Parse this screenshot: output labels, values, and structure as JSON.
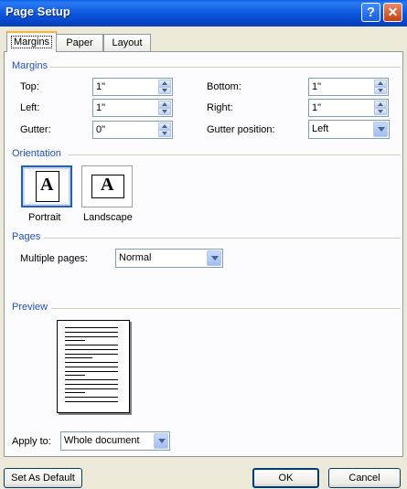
{
  "window": {
    "title": "Page Setup",
    "help_glyph": "?",
    "close_glyph": "✕"
  },
  "tabs": [
    {
      "label": "Margins",
      "active": true
    },
    {
      "label": "Paper",
      "active": false
    },
    {
      "label": "Layout",
      "active": false
    }
  ],
  "margins": {
    "section_label": "Margins",
    "top": {
      "label": "Top:",
      "value": "1\""
    },
    "bottom": {
      "label": "Bottom:",
      "value": "1\""
    },
    "left": {
      "label": "Left:",
      "value": "1\""
    },
    "right": {
      "label": "Right:",
      "value": "1\""
    },
    "gutter": {
      "label": "Gutter:",
      "value": "0\""
    },
    "gutter_position": {
      "label": "Gutter position:",
      "value": "Left"
    }
  },
  "orientation": {
    "section_label": "Orientation",
    "portrait": {
      "label": "Portrait",
      "glyph": "A",
      "selected": true
    },
    "landscape": {
      "label": "Landscape",
      "glyph": "A",
      "selected": false
    }
  },
  "pages": {
    "section_label": "Pages",
    "multiple_pages": {
      "label": "Multiple pages:",
      "value": "Normal"
    }
  },
  "preview": {
    "section_label": "Preview"
  },
  "apply_to": {
    "label": "Apply to:",
    "value": "Whole document"
  },
  "buttons": {
    "set_default": "Set As Default",
    "ok": "OK",
    "cancel": "Cancel"
  },
  "colors": {
    "titlebar": "#0a5fe8",
    "group_header": "#2150c0",
    "dialog_bg": "#ece9d8",
    "active_tab_accent": "#f8b53b"
  }
}
